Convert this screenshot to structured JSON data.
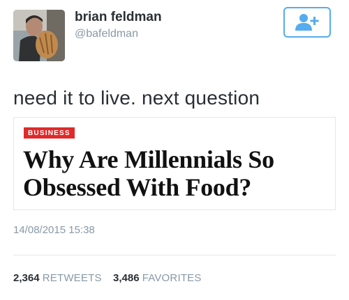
{
  "user": {
    "name": "brian feldman",
    "handle": "@bafeldman"
  },
  "follow_icon": "add-user-icon",
  "tweet": {
    "text": "need it to live. next question",
    "timestamp": "14/08/2015 15:38"
  },
  "card": {
    "label": "BUSINESS",
    "headline": "Why Are Millennials So Obsessed With Food?"
  },
  "stats": {
    "retweets_count": "2,364",
    "retweets_label": "RETWEETS",
    "favorites_count": "3,486",
    "favorites_label": "FAVORITES"
  },
  "colors": {
    "accent": "#55acee",
    "label_red": "#e02a2a",
    "muted": "#8899a6"
  }
}
